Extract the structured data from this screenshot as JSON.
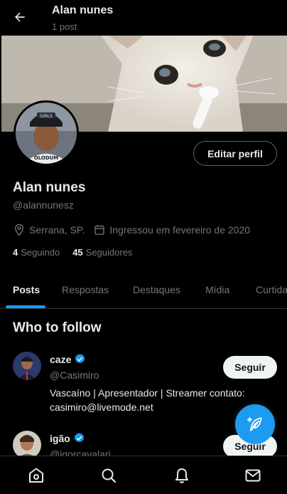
{
  "header": {
    "title": "Alan nunes",
    "subtitle": "1 post",
    "back_icon": "arrow-left-icon"
  },
  "profile": {
    "name": "Alan nunes",
    "handle": "@alannunesz",
    "location": "Serrana, SP.",
    "joined": "Ingressou em fevereiro de 2020",
    "following_count": "4",
    "following_label": "Seguindo",
    "followers_count": "45",
    "followers_label": "Seguidores",
    "edit_label": "Editar perfil",
    "avatar_cap_text": "GIRLS",
    "avatar_shirt_text": "OLODUM"
  },
  "tabs": [
    {
      "label": "Posts",
      "active": true
    },
    {
      "label": "Respostas",
      "active": false
    },
    {
      "label": "Destaques",
      "active": false
    },
    {
      "label": "Mídia",
      "active": false
    },
    {
      "label": "Curtidas",
      "active": false
    }
  ],
  "who_to_follow": {
    "title": "Who to follow",
    "items": [
      {
        "name": "caze",
        "handle": "@Casimiro",
        "bio": "Vascaíno | Apresentador | Streamer contato: casimiro@livemode.net",
        "verified": true,
        "follow_label": "Seguir"
      },
      {
        "name": "igão",
        "handle": "@igorcavalari",
        "bio": "",
        "verified": true,
        "follow_label": "Seguir"
      }
    ]
  },
  "bottom_nav": [
    {
      "name": "home-icon"
    },
    {
      "name": "search-icon"
    },
    {
      "name": "notifications-bell-icon"
    },
    {
      "name": "messages-envelope-icon"
    }
  ],
  "colors": {
    "background": "#000000",
    "accent": "#1d9bf0",
    "text_primary": "#e7e9ea",
    "text_secondary": "#71767b",
    "border": "#2f3336"
  }
}
